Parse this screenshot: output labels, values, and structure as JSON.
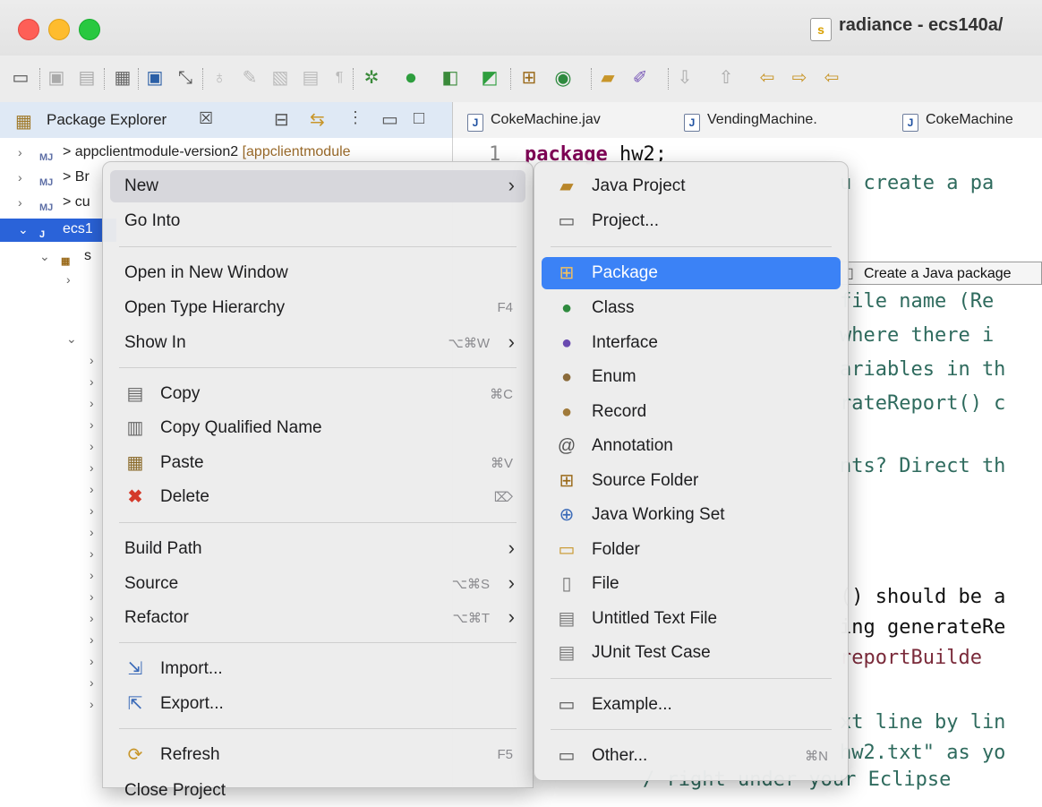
{
  "window": {
    "title": "radiance - ecs140a/"
  },
  "toolbar": {
    "icons": [
      "new-icon",
      "save-icon",
      "save-all-icon",
      "binary-icon",
      "console-icon",
      "link-icon",
      "light-icon",
      "pen-icon",
      "annotate-icon",
      "doc-icon",
      "pilcrow-icon",
      "debug-icon",
      "run-icon",
      "coverage-icon",
      "external-tools-icon",
      "new-package-icon",
      "new-class-icon",
      "open-folder-icon",
      "brush-icon",
      "next-annotation-icon",
      "prev-annotation-icon",
      "back-history-icon",
      "forward-history-icon",
      "back-icon"
    ]
  },
  "views": {
    "package_explorer": {
      "label": "Package Explorer",
      "close": "☒"
    },
    "editor_tabs": [
      {
        "label": "CokeMachine.jav"
      },
      {
        "label": "VendingMachine."
      },
      {
        "label": "CokeMachine"
      }
    ]
  },
  "tree": {
    "rows": [
      {
        "name": "appclientmodule-version2",
        "suffix": "[appclientmodule"
      },
      {
        "name": "Br"
      },
      {
        "name": "cu"
      },
      {
        "name": "ecs1"
      },
      {
        "name": "s"
      }
    ]
  },
  "editor": {
    "line_number": "1",
    "line1_keyword": "package",
    "line1_rest": " hw2;",
    "fragments": [
      "u create a pa",
      "file name (Re",
      "where there i",
      "ariables in th",
      "rateReport() c",
      "nts? Direct th",
      "() should be a",
      "ing generateRe",
      " reportBuilde",
      "xt line by lin",
      "hw2.txt\" as yo",
      "/ right under your Eclipse"
    ]
  },
  "context_menu": {
    "items": [
      {
        "label": "New",
        "arrow": "›",
        "highlighted": true
      },
      {
        "label": "Go Into"
      },
      {
        "label": "Open in New Window"
      },
      {
        "label": "Open Type Hierarchy",
        "shortcut": "F4"
      },
      {
        "label": "Show In",
        "shortcut": "⌥⌘W",
        "arrow": "›"
      },
      {
        "label": "Copy",
        "shortcut": "⌘C",
        "icon": "copy-icon"
      },
      {
        "label": "Copy Qualified Name",
        "icon": "copy-qualified-icon"
      },
      {
        "label": "Paste",
        "shortcut": "⌘V",
        "icon": "paste-icon"
      },
      {
        "label": "Delete",
        "shortcut": "⌦",
        "icon": "delete-icon"
      },
      {
        "label": "Build Path",
        "arrow": "›"
      },
      {
        "label": "Source",
        "shortcut": "⌥⌘S",
        "arrow": "›"
      },
      {
        "label": "Refactor",
        "shortcut": "⌥⌘T",
        "arrow": "›"
      },
      {
        "label": "Import...",
        "icon": "import-icon"
      },
      {
        "label": "Export...",
        "icon": "export-icon"
      },
      {
        "label": "Refresh",
        "shortcut": "F5",
        "icon": "refresh-icon"
      },
      {
        "label": "Close Project"
      }
    ]
  },
  "submenu": {
    "items": [
      {
        "label": "Java Project",
        "icon": "java-project-icon"
      },
      {
        "label": "Project...",
        "icon": "project-icon"
      },
      {
        "label": "Package",
        "icon": "package-icon",
        "highlighted": true
      },
      {
        "label": "Class",
        "icon": "class-icon"
      },
      {
        "label": "Interface",
        "icon": "interface-icon"
      },
      {
        "label": "Enum",
        "icon": "enum-icon"
      },
      {
        "label": "Record",
        "icon": "record-icon"
      },
      {
        "label": "Annotation",
        "icon": "annotation-icon"
      },
      {
        "label": "Source Folder",
        "icon": "source-folder-icon"
      },
      {
        "label": "Java Working Set",
        "icon": "working-set-icon"
      },
      {
        "label": "Folder",
        "icon": "folder-icon"
      },
      {
        "label": "File",
        "icon": "file-icon"
      },
      {
        "label": "Untitled Text File",
        "icon": "text-file-icon"
      },
      {
        "label": "JUnit Test Case",
        "icon": "junit-icon"
      },
      {
        "label": "Example...",
        "icon": "example-icon"
      },
      {
        "label": "Other...",
        "icon": "other-icon",
        "shortcut": "⌘N"
      }
    ]
  },
  "tooltip": {
    "text": "Create a Java package"
  },
  "colors": {
    "highlight": "#3b82f6",
    "selection": "#2a63d9",
    "keyword": "#7f0055",
    "comment": "#2f6b5e"
  }
}
